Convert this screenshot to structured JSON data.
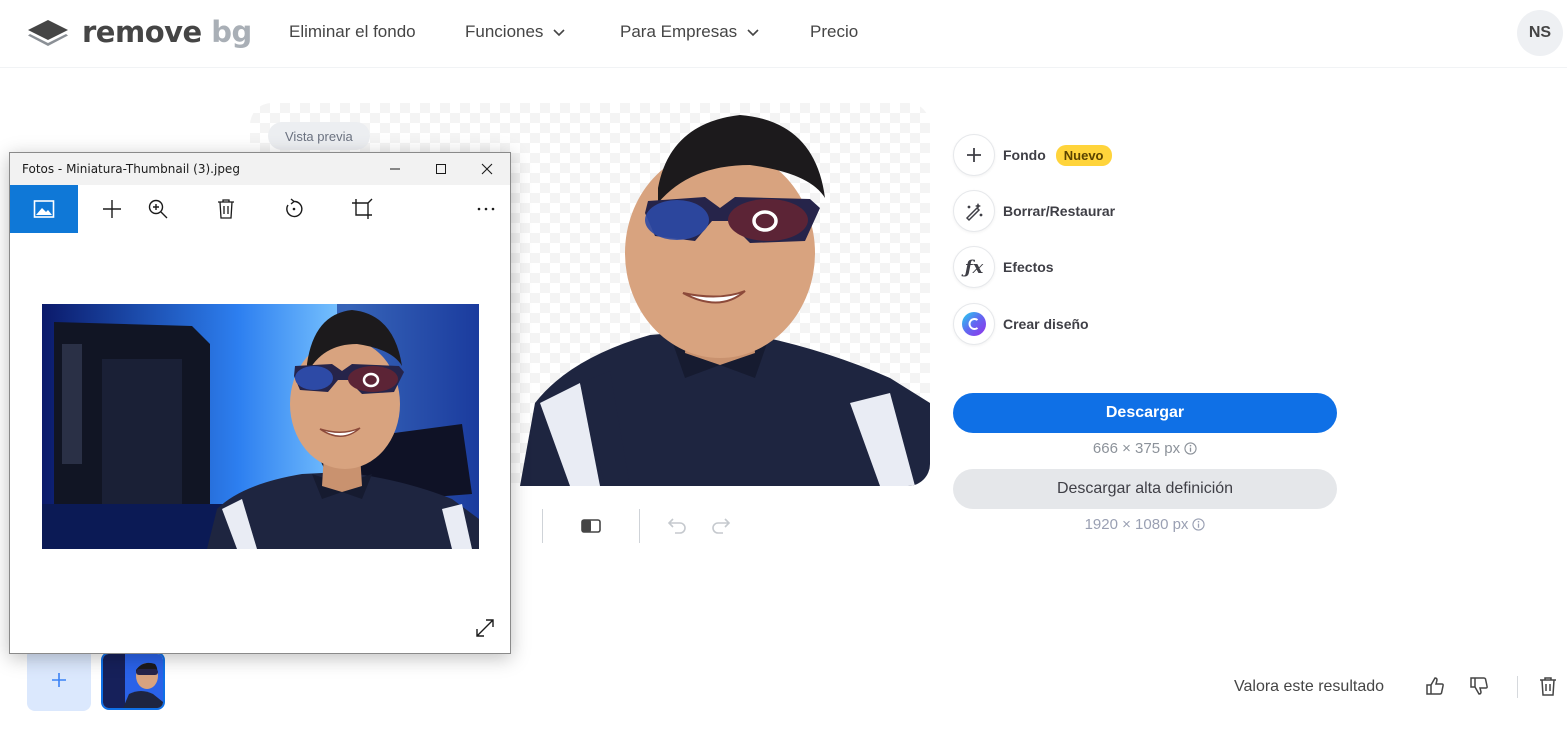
{
  "header": {
    "logo_main": "remove",
    "logo_accent": "bg",
    "nav": [
      "Eliminar el fondo",
      "Funciones",
      "Para Empresas",
      "Precio"
    ],
    "avatar_initials": "NS"
  },
  "preview": {
    "tag": "Vista previa"
  },
  "tools": {
    "background": "Fondo",
    "background_badge": "Nuevo",
    "erase_restore": "Borrar/Restaurar",
    "effects": "Efectos",
    "create_design": "Crear diseño"
  },
  "download": {
    "label": "Descargar",
    "resolution": "666 × 375 px",
    "hd_label": "Descargar alta definición",
    "hd_resolution": "1920 × 1080 px"
  },
  "rating": {
    "label": "Valora este resultado"
  },
  "photos_window": {
    "title": "Fotos - Miniatura-Thumbnail (3).jpeg"
  },
  "colors": {
    "accent": "#0f70e6",
    "badge": "#ffd43b",
    "photos_accent": "#0f78d7"
  }
}
